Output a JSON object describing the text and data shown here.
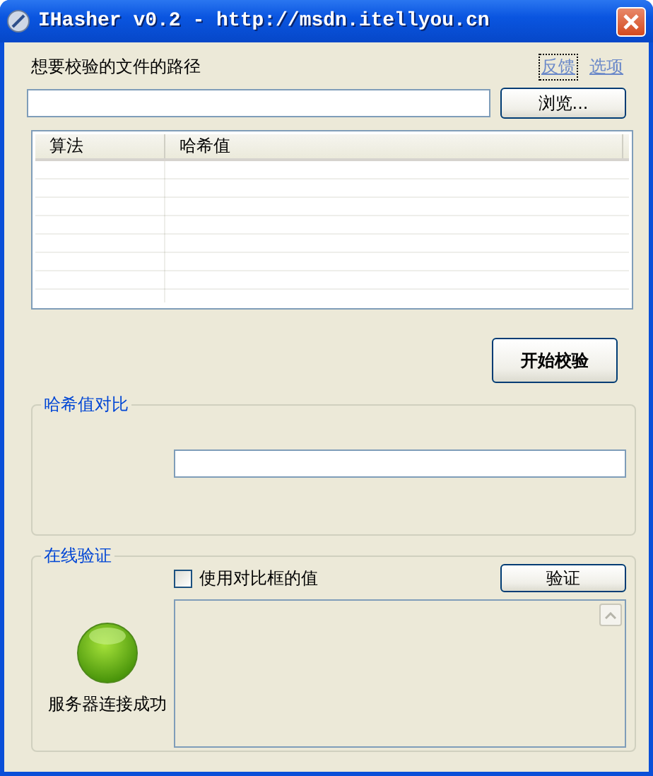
{
  "window": {
    "title": "IHasher v0.2 - http://msdn.itellyou.cn"
  },
  "path_label": "想要校验的文件的路径",
  "links": [
    {
      "label": "反馈",
      "focused": true
    },
    {
      "label": "选项",
      "focused": false
    }
  ],
  "browse_button": "浏览...",
  "table": {
    "columns": [
      "算法",
      "哈希值"
    ]
  },
  "start_button": "开始校验",
  "compare_group": {
    "title": "哈希值对比"
  },
  "online_group": {
    "title": "在线验证",
    "checkbox": {
      "label": "使用对比框的值",
      "checked": false
    },
    "verify_button": "验证",
    "status": "服务器连接成功"
  }
}
